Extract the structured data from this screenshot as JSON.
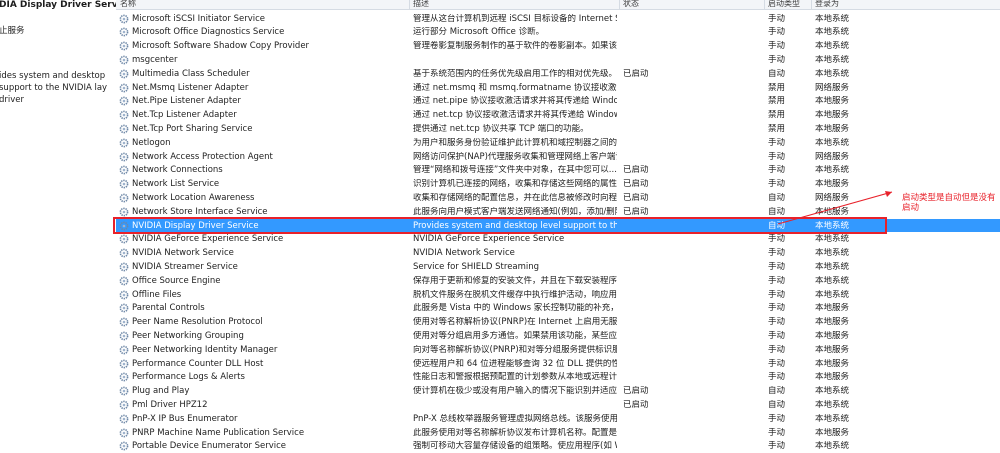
{
  "left_pane": {
    "title": "DIA Display Driver Service",
    "link": "止服务",
    "description": "ides system and desktop support to the NVIDIA lay driver"
  },
  "columns": {
    "name": "名称",
    "description": "描述",
    "status": "状态",
    "startup": "启动类型",
    "logon": "登录为"
  },
  "services": [
    {
      "name": "Microsoft iSCSI Initiator Service",
      "description": "管理从这台计算机到远程 iSCSI 目标设备的 Internet SC...",
      "status": "",
      "startup": "手动",
      "logon": "本地系统"
    },
    {
      "name": "Microsoft Office Diagnostics Service",
      "description": "运行部分 Microsoft Office 诊断。",
      "status": "",
      "startup": "手动",
      "logon": "本地系统"
    },
    {
      "name": "Microsoft Software Shadow Copy Provider",
      "description": "管理卷影复制服务制作的基于软件的卷影副本。如果该...",
      "status": "",
      "startup": "手动",
      "logon": "本地系统"
    },
    {
      "name": "msgcenter",
      "description": "",
      "status": "",
      "startup": "手动",
      "logon": "本地系统"
    },
    {
      "name": "Multimedia Class Scheduler",
      "description": "基于系统范围内的任务优先级启用工作的相对优先级。...",
      "status": "已启动",
      "startup": "自动",
      "logon": "本地系统"
    },
    {
      "name": "Net.Msmq Listener Adapter",
      "description": "通过 net.msmq 和 msmq.formatname 协议接收激活...",
      "status": "",
      "startup": "禁用",
      "logon": "网络服务"
    },
    {
      "name": "Net.Pipe Listener Adapter",
      "description": "通过 net.pipe 协议接收激活请求并将其传递给 Window...",
      "status": "",
      "startup": "禁用",
      "logon": "本地服务"
    },
    {
      "name": "Net.Tcp Listener Adapter",
      "description": "通过 net.tcp 协议接收激活请求并将其传递给 Windows...",
      "status": "",
      "startup": "禁用",
      "logon": "本地服务"
    },
    {
      "name": "Net.Tcp Port Sharing Service",
      "description": "提供通过 net.tcp 协议共享 TCP 端口的功能。",
      "status": "",
      "startup": "禁用",
      "logon": "本地服务"
    },
    {
      "name": "Netlogon",
      "description": "为用户和服务身份验证维护此计算机和域控制器之间的...",
      "status": "",
      "startup": "手动",
      "logon": "本地系统"
    },
    {
      "name": "Network Access Protection Agent",
      "description": "网络访问保护(NAP)代理服务收集和管理网络上客户端计...",
      "status": "",
      "startup": "手动",
      "logon": "网络服务"
    },
    {
      "name": "Network Connections",
      "description": "管理“网络和拨号连接”文件夹中对象，在其中您可以...",
      "status": "已启动",
      "startup": "手动",
      "logon": "本地系统"
    },
    {
      "name": "Network List Service",
      "description": "识别计算机已连接的网络，收集和存储这些网络的属性...",
      "status": "已启动",
      "startup": "手动",
      "logon": "本地服务"
    },
    {
      "name": "Network Location Awareness",
      "description": "收集和存储网络的配置信息，并在此信息被修改时向程...",
      "status": "已启动",
      "startup": "自动",
      "logon": "网络服务"
    },
    {
      "name": "Network Store Interface Service",
      "description": "此服务向用户模式客户端发送网络通知(例如，添加/删除...",
      "status": "已启动",
      "startup": "自动",
      "logon": "本地服务"
    },
    {
      "name": "NVIDIA Display Driver Service",
      "description": "Provides system and desktop level support to the ...",
      "status": "",
      "startup": "自动",
      "logon": "本地系统"
    },
    {
      "name": "NVIDIA GeForce Experience Service",
      "description": "NVIDIA GeForce Experience Service",
      "status": "",
      "startup": "手动",
      "logon": "本地系统"
    },
    {
      "name": "NVIDIA Network Service",
      "description": "NVIDIA Network Service",
      "status": "",
      "startup": "手动",
      "logon": "本地系统"
    },
    {
      "name": "NVIDIA Streamer Service",
      "description": "Service for SHIELD Streaming",
      "status": "",
      "startup": "手动",
      "logon": "本地系统"
    },
    {
      "name": "Office Source Engine",
      "description": "保存用于更新和修复的安装文件，并且在下载安装程序...",
      "status": "",
      "startup": "手动",
      "logon": "本地系统"
    },
    {
      "name": "Offline Files",
      "description": "脱机文件服务在脱机文件缓存中执行维护活动，响应用...",
      "status": "",
      "startup": "手动",
      "logon": "本地系统"
    },
    {
      "name": "Parental Controls",
      "description": "此服务是 Vista 中的 Windows 家长控制功能的补充，...",
      "status": "",
      "startup": "手动",
      "logon": "本地服务"
    },
    {
      "name": "Peer Name Resolution Protocol",
      "description": "使用对等名称解析协议(PNRP)在 Internet 上启用无服务...",
      "status": "",
      "startup": "手动",
      "logon": "本地服务"
    },
    {
      "name": "Peer Networking Grouping",
      "description": "使用对等分组启用多方通信。如果禁用该功能，某些应...",
      "status": "",
      "startup": "手动",
      "logon": "本地服务"
    },
    {
      "name": "Peer Networking Identity Manager",
      "description": "向对等名称解析协议(PNRP)和对等分组服务提供标识服...",
      "status": "",
      "startup": "手动",
      "logon": "本地服务"
    },
    {
      "name": "Performance Counter DLL Host",
      "description": "使远程用户和 64 位进程能够查询 32 位 DLL 提供的性...",
      "status": "",
      "startup": "手动",
      "logon": "本地服务"
    },
    {
      "name": "Performance Logs & Alerts",
      "description": "性能日志和警报根据预配置的计划参数从本地或远程计...",
      "status": "",
      "startup": "手动",
      "logon": "本地服务"
    },
    {
      "name": "Plug and Play",
      "description": "使计算机在极少或没有用户输入的情况下能识别并适应...",
      "status": "已启动",
      "startup": "自动",
      "logon": "本地系统"
    },
    {
      "name": "Pml Driver HPZ12",
      "description": "",
      "status": "已启动",
      "startup": "自动",
      "logon": "本地系统"
    },
    {
      "name": "PnP-X IP Bus Enumerator",
      "description": "PnP-X 总线枚举器服务管理虚拟网络总线。该服务使用 ...",
      "status": "",
      "startup": "手动",
      "logon": "本地系统"
    },
    {
      "name": "PNRP Machine Name Publication Service",
      "description": "此服务使用对等名称解析协议发布计算机名称。配置是...",
      "status": "",
      "startup": "手动",
      "logon": "本地服务"
    },
    {
      "name": "Portable Device Enumerator Service",
      "description": "强制可移动大容量存储设备的组策略。使应用程序(如 W...",
      "status": "",
      "startup": "手动",
      "logon": "本地系统"
    }
  ],
  "selected_index": 15,
  "annotation": "启动类型是自动但是没有启动",
  "colors": {
    "selection": "#3399ff",
    "annotation": "#e8212a",
    "header_bg": "#f3f5f8"
  },
  "icons": {
    "service": "gear-icon"
  }
}
